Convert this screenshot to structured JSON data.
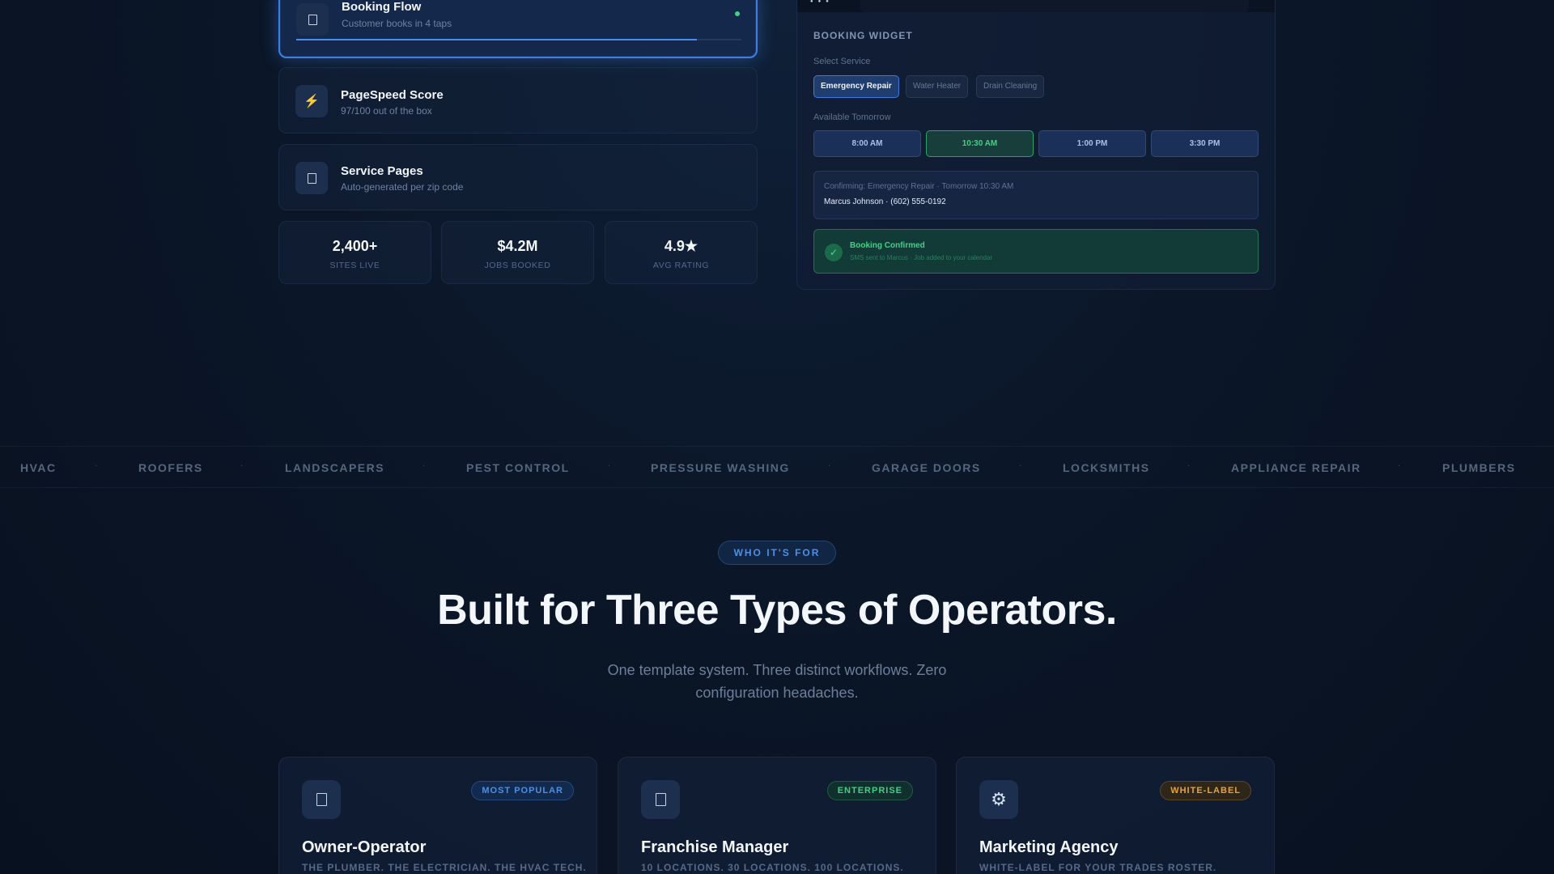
{
  "features": [
    {
      "title": "Booking Flow",
      "subtitle": "Customer books in 4 taps",
      "icon": "phone-icon",
      "progress_fraction": 0.9
    },
    {
      "title": "PageSpeed Score",
      "subtitle": "97/100 out of the box",
      "icon": "lightning-icon",
      "glyph": "⚡"
    },
    {
      "title": "Service Pages",
      "subtitle": "Auto-generated per zip code",
      "icon": "document-icon"
    }
  ],
  "stats": [
    {
      "value": "2,400+",
      "label": "SITES LIVE"
    },
    {
      "value": "$4.2M",
      "label": "JOBS BOOKED"
    },
    {
      "value": "4.9★",
      "label": "AVG RATING"
    }
  ],
  "widget": {
    "title": "BOOKING WIDGET",
    "select_service_label": "Select Service",
    "services": [
      "Emergency Repair",
      "Water Heater",
      "Drain Cleaning"
    ],
    "selected_service": "Emergency Repair",
    "available_label": "Available Tomorrow",
    "slots": [
      "8:00 AM",
      "10:30 AM",
      "1:00 PM",
      "3:30 PM"
    ],
    "selected_slot": "10:30 AM",
    "confirming_text": "Confirming: Emergency Repair · Tomorrow 10:30 AM",
    "customer_text": "Marcus Johnson · (602) 555-0192",
    "success_title": "Booking Confirmed",
    "success_sub": "SMS sent to Marcus · Job added to your calendar",
    "success_color": "#3fd484"
  },
  "trades": [
    "HVAC",
    "ROOFERS",
    "LANDSCAPERS",
    "PEST CONTROL",
    "PRESSURE WASHING",
    "GARAGE DOORS",
    "LOCKSMITHS",
    "APPLIANCE REPAIR",
    "PLUMBERS"
  ],
  "section": {
    "badge": "WHO IT'S FOR",
    "heading": "Built for Three Types of Operators.",
    "lede": "One template system. Three distinct workflows. Zero configuration headaches."
  },
  "cards": [
    {
      "tag": "MOST POPULAR",
      "tag_color": "#4e8fe6",
      "icon": "wrench-icon",
      "name": "Owner-Operator",
      "desc": "THE PLUMBER. THE ELECTRICIAN. THE HVAC TECH."
    },
    {
      "tag": "ENTERPRISE",
      "tag_color": "#3fcf86",
      "icon": "building-icon",
      "name": "Franchise Manager",
      "desc": "10 LOCATIONS. 30 LOCATIONS. 100 LOCATIONS."
    },
    {
      "tag": "WHITE-LABEL",
      "tag_color": "#e6a23a",
      "icon": "gear-icon",
      "glyph": "⚙",
      "name": "Marketing Agency",
      "desc": "WHITE-LABEL FOR YOUR TRADES ROSTER."
    }
  ],
  "colors": {
    "accent": "#3d7fe0",
    "success": "#3fd484",
    "background": "#0b1628"
  }
}
